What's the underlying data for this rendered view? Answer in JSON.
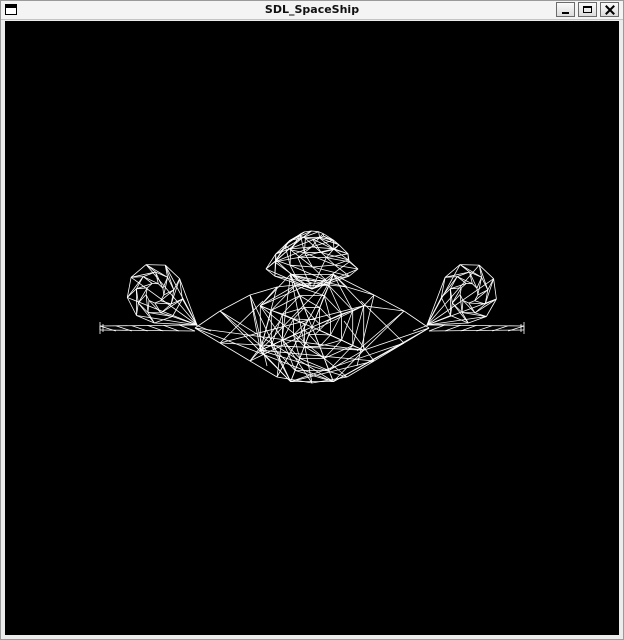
{
  "window": {
    "title": "SDL_SpaceShip",
    "background_color": "#000000",
    "wire_color": "#ffffff"
  },
  "titlebar": {
    "system_icon": "window-menu-icon",
    "minimize_icon": "minimize-icon",
    "maximize_icon": "maximize-icon",
    "close_icon": "close-icon"
  },
  "scene": {
    "model": "spaceship-wireframe",
    "render_mode": "wireframe"
  }
}
